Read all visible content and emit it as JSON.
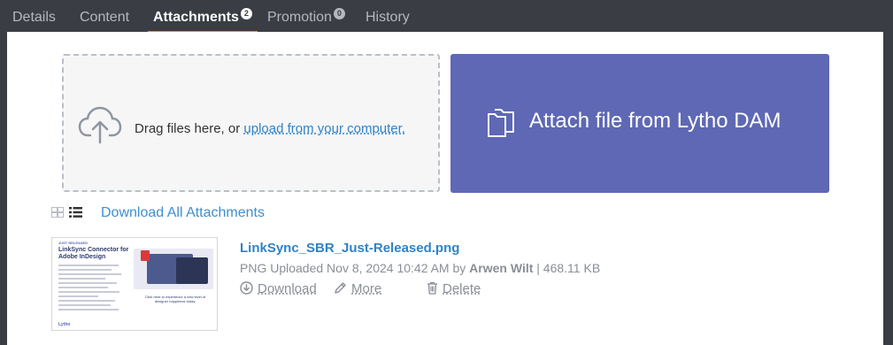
{
  "tabs": [
    {
      "label": "Details",
      "active": false
    },
    {
      "label": "Content",
      "active": false
    },
    {
      "label": "Attachments",
      "active": true,
      "badge": "2"
    },
    {
      "label": "Promotion",
      "active": false,
      "badge": "0"
    },
    {
      "label": "History",
      "active": false
    }
  ],
  "dropzone": {
    "text": "Drag files here, or ",
    "link": "upload from your computer.",
    "icon": "cloud-upload-icon"
  },
  "dam_button": {
    "label": "Attach file from Lytho DAM",
    "icon": "folder-icon"
  },
  "view_toggle": {
    "grid_icon": "grid-view-icon",
    "list_icon": "list-view-icon",
    "active": "list"
  },
  "download_all": "Download All Attachments",
  "attachment": {
    "file_name": "LinkSync_SBR_Just-Released.png",
    "meta_prefix": "PNG Uploaded Nov 8, 2024 10:42 AM by ",
    "uploader": "Arwen Wilt",
    "meta_suffix": " | 468.11 KB",
    "actions": {
      "download": "Download",
      "more": "More",
      "delete": "Delete"
    },
    "thumbnail": {
      "tag": "JUST RELEASED",
      "title": "LinkSync Connector for Adobe InDesign",
      "caption": "Click here to experience a new level of designer happiness today.",
      "logo": "Lytho"
    }
  },
  "colors": {
    "tabbar_bg": "#3a3d44",
    "active_underline": "#f08a24",
    "dam_button_bg": "#5e68b4",
    "link_blue": "#2f83c7"
  }
}
